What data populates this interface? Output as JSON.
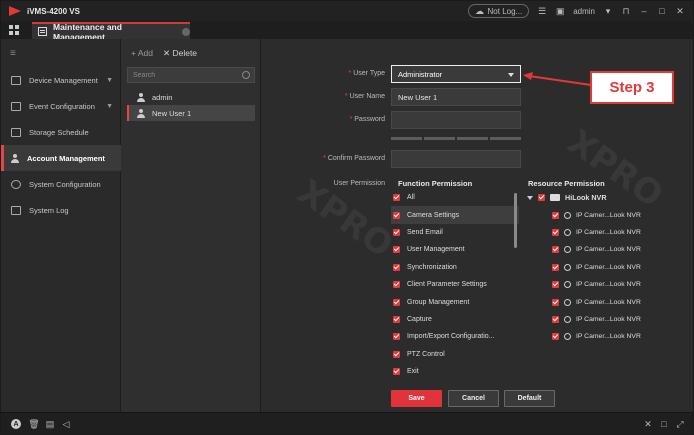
{
  "app": {
    "title": "iVMS-4200 VS",
    "login_status": "Not Log...",
    "user": "admin"
  },
  "tab": {
    "label": "Maintenance and Management"
  },
  "sidebar": {
    "items": [
      {
        "label": "Device Management",
        "icon": "device-icon",
        "has_arrow": true
      },
      {
        "label": "Event Configuration",
        "icon": "event-icon",
        "has_arrow": true
      },
      {
        "label": "Storage Schedule",
        "icon": "storage-icon",
        "has_arrow": false
      },
      {
        "label": "Account Management",
        "icon": "account-icon",
        "has_arrow": false,
        "active": true
      },
      {
        "label": "System Configuration",
        "icon": "gear-icon",
        "has_arrow": false
      },
      {
        "label": "System Log",
        "icon": "log-icon",
        "has_arrow": false
      }
    ]
  },
  "users": {
    "add_label": "Add",
    "delete_label": "Delete",
    "search_placeholder": "Search",
    "list": [
      "admin",
      "New User 1"
    ],
    "selected": "New User 1"
  },
  "form": {
    "user_type_label": "User Type",
    "user_type_value": "Administrator",
    "user_name_label": "User Name",
    "user_name_value": "New User 1",
    "password_label": "Password",
    "password_value": "",
    "confirm_password_label": "Confirm Password",
    "confirm_password_value": "",
    "user_permission_label": "User Permission",
    "function_permission_title": "Function Permission",
    "resource_permission_title": "Resource Permission"
  },
  "function_permissions": [
    "All",
    "Camera Settings",
    "Send Email",
    "User Management",
    "Synchronization",
    "Client Parameter Settings",
    "Group Management",
    "Capture",
    "Import/Export Configuratio...",
    "PTZ Control",
    "Exit"
  ],
  "resource_tree": {
    "root": "HiLook NVR",
    "children": [
      "IP Camer...Look NVR",
      "IP Camer...Look NVR",
      "IP Camer...Look NVR",
      "IP Camer...Look NVR",
      "IP Camer...Look NVR",
      "IP Camer...Look NVR",
      "IP Camer...Look NVR",
      "IP Camer...Look NVR"
    ]
  },
  "buttons": {
    "save": "Save",
    "cancel": "Cancel",
    "default": "Default"
  },
  "annotation": {
    "label": "Step 3"
  },
  "colors": {
    "accent": "#e0343a",
    "background": "#2c2c2c",
    "callout": "#e23838"
  }
}
